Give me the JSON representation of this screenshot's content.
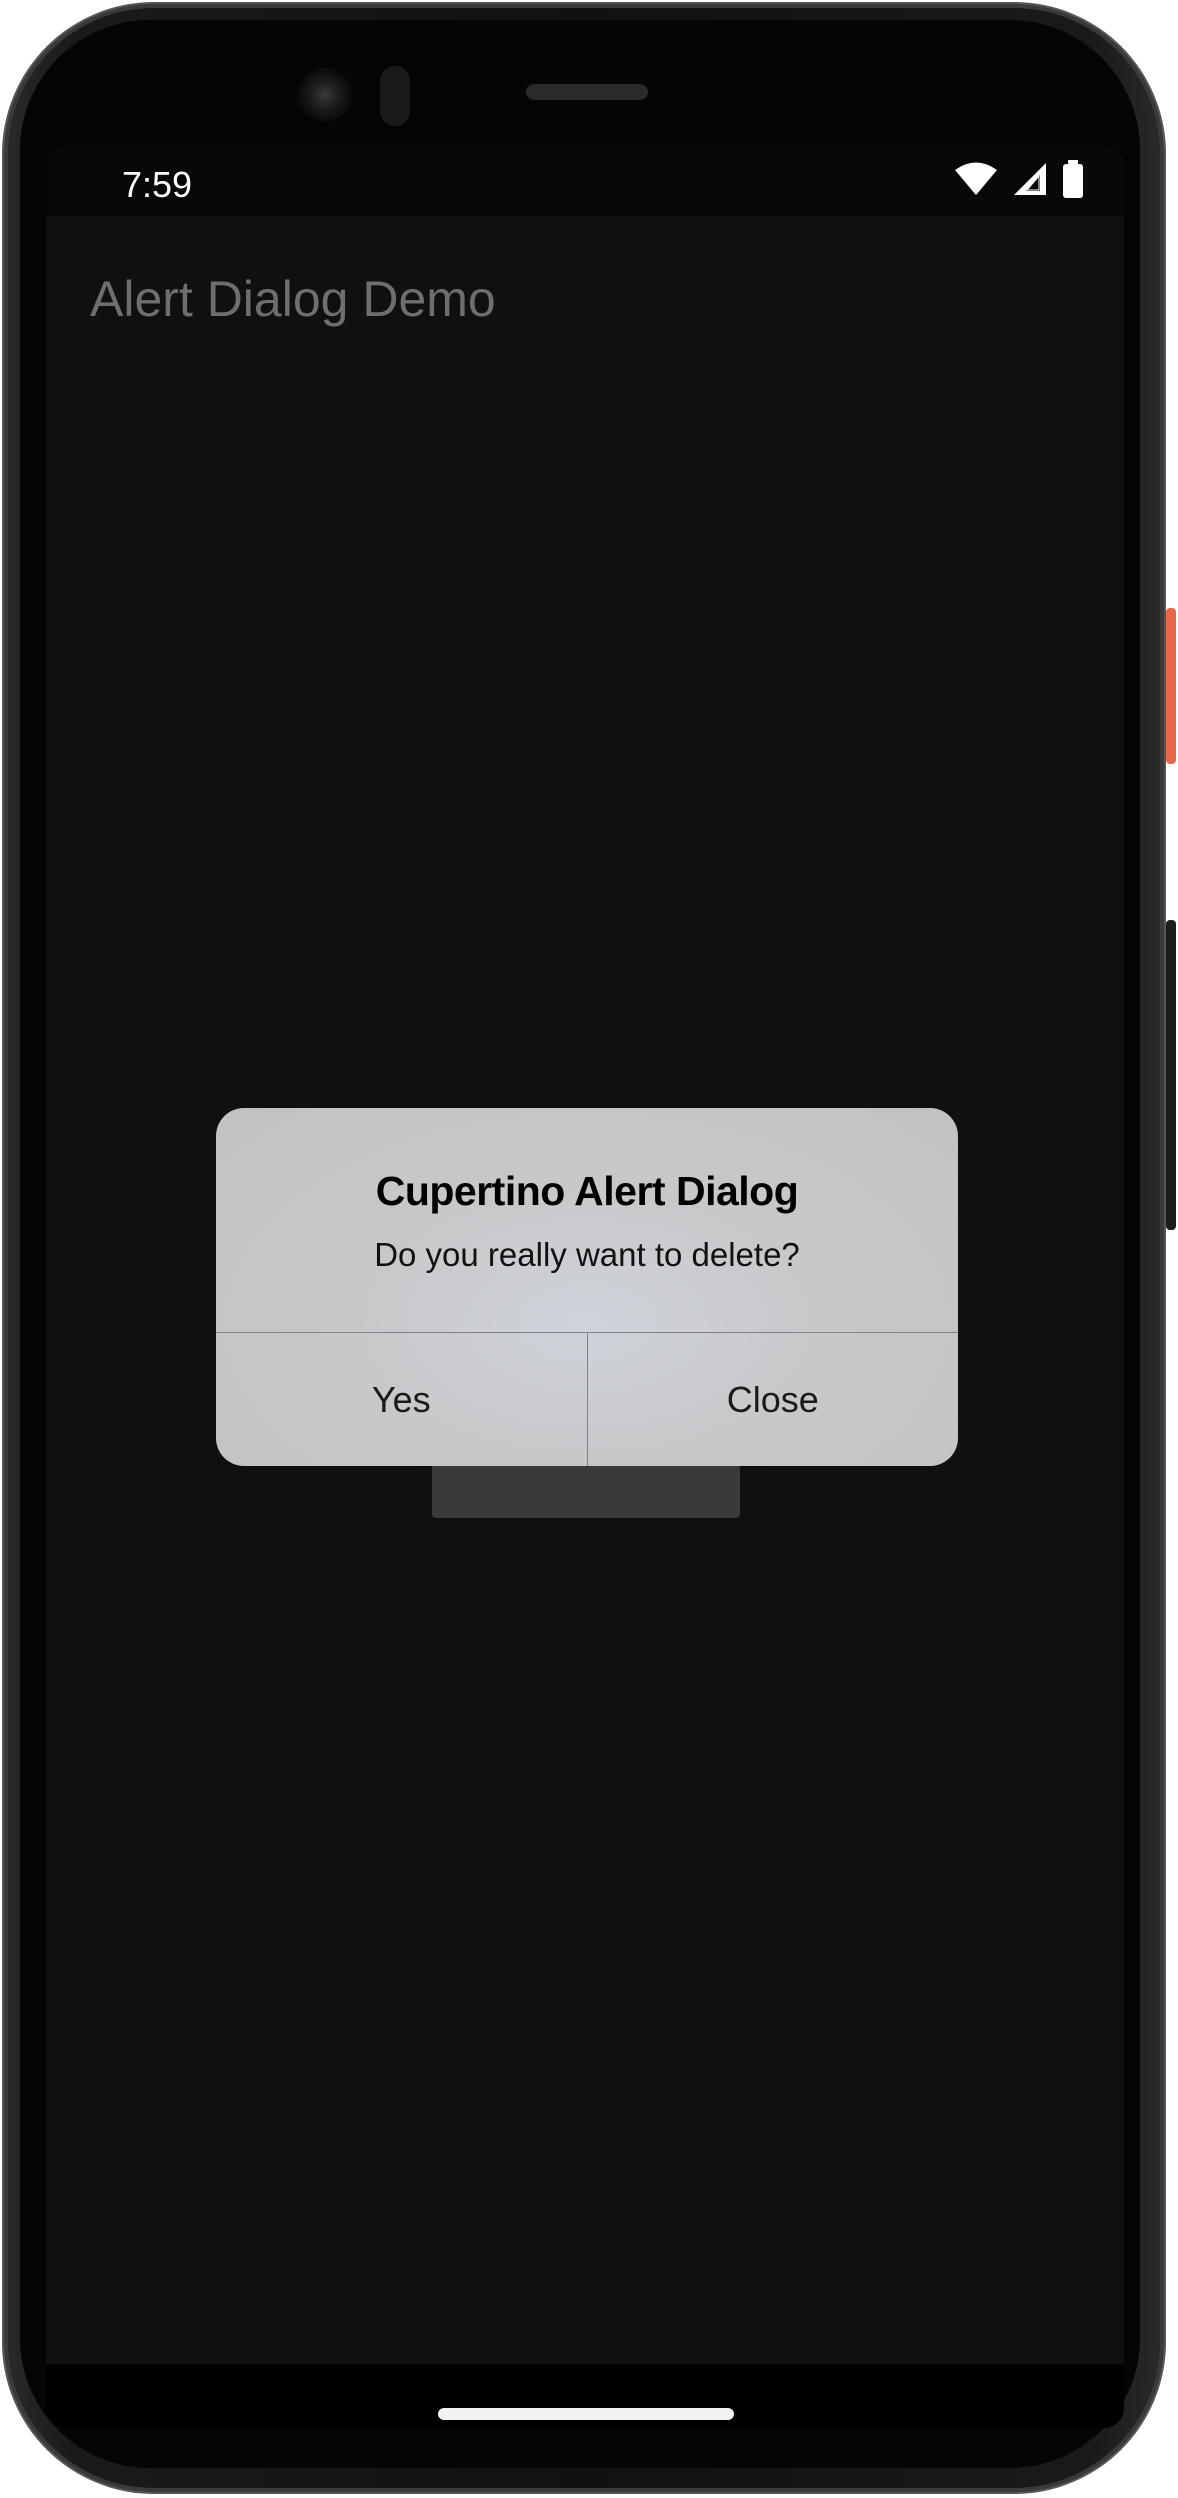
{
  "status_bar": {
    "time": "7:59",
    "icons": [
      "wifi-icon",
      "cellular-signal-icon",
      "battery-icon"
    ]
  },
  "app_bar": {
    "title": "Alert Dialog Demo"
  },
  "dialog": {
    "title": "Cupertino Alert Dialog",
    "message": "Do you really want to delete?",
    "actions": [
      {
        "label": "Yes"
      },
      {
        "label": "Close"
      }
    ]
  },
  "colors": {
    "screen_background": "#101010",
    "app_title": "#6e6e6e",
    "dialog_background": "#c4c4c4",
    "dialog_divider": "#7f8088",
    "power_button": "#e8674a"
  }
}
